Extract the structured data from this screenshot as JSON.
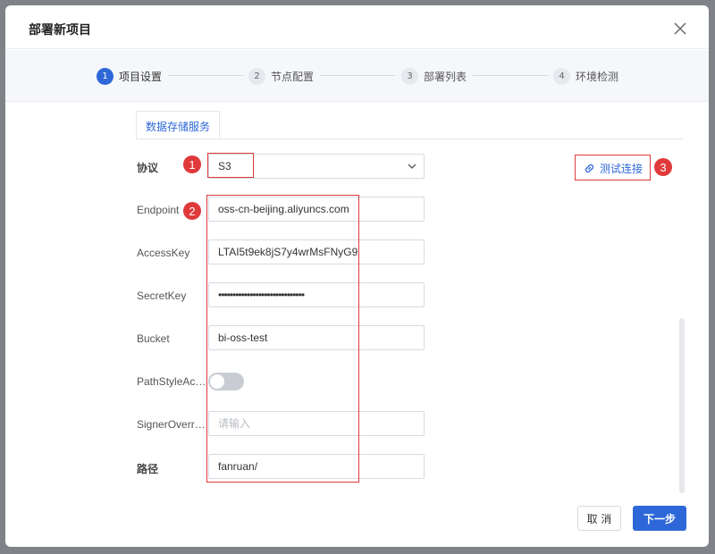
{
  "dialog": {
    "title": "部署新项目",
    "close_icon": "close-icon"
  },
  "steps": [
    {
      "num": "1",
      "label": "项目设置"
    },
    {
      "num": "2",
      "label": "节点配置"
    },
    {
      "num": "3",
      "label": "部署列表"
    },
    {
      "num": "4",
      "label": "环境检测"
    }
  ],
  "tab": {
    "label": "数据存储服务"
  },
  "form": {
    "protocol": {
      "label": "协议",
      "value": "S3"
    },
    "endpoint": {
      "label": "Endpoint",
      "value": "oss-cn-beijing.aliyuncs.com"
    },
    "accesskey": {
      "label": "AccessKey",
      "value": "LTAI5t9ek8jS7y4wrMsFNyG9"
    },
    "secretkey": {
      "label": "SecretKey",
      "value": "••••••••••••••••••••••••••••••"
    },
    "bucket": {
      "label": "Bucket",
      "value": "bi-oss-test"
    },
    "pathstyle": {
      "label": "PathStyleAccess",
      "enabled": false
    },
    "signer": {
      "label": "SignerOverride",
      "placeholder": "请输入"
    },
    "path": {
      "label": "路径",
      "value": "fanruan/"
    }
  },
  "test_connection": {
    "label": "测试连接",
    "icon": "link-icon"
  },
  "annotations": [
    "1",
    "2",
    "3"
  ],
  "footer": {
    "cancel_label": "取 消",
    "next_label": "下一步"
  },
  "colors": {
    "primary": "#2e68d8",
    "annotation": "#e0393a"
  }
}
